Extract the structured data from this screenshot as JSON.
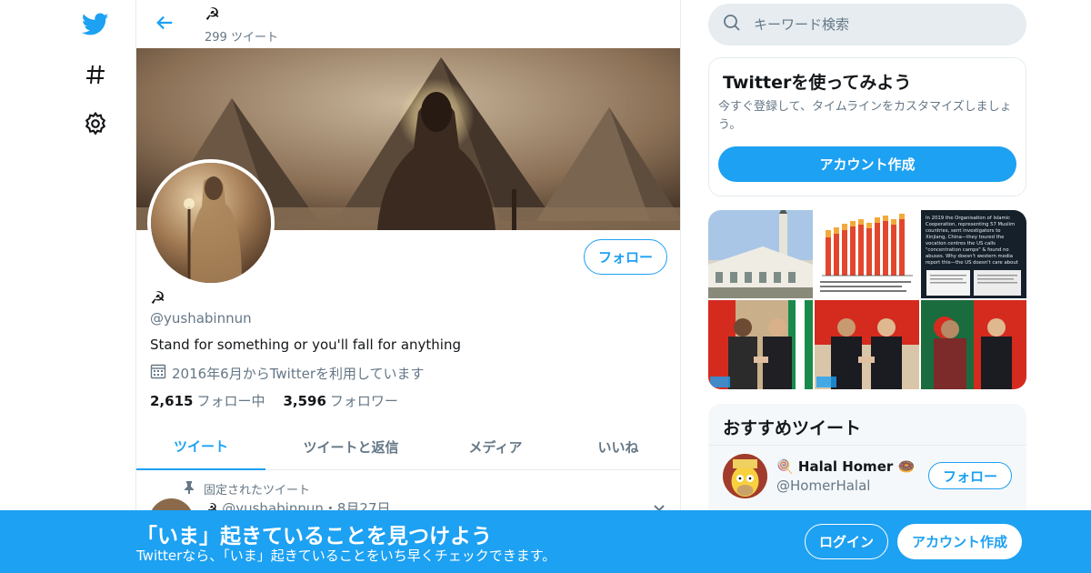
{
  "nav": {
    "icons": [
      "twitter-logo-icon",
      "hashtag-icon",
      "gear-icon"
    ]
  },
  "profile": {
    "display_name": "☭",
    "tweet_count": "299 ツイート",
    "handle": "@yushabinnun",
    "bio": "Stand for something or you'll fall for anything",
    "joined": "2016年6月からTwitterを利用しています",
    "following_count": "2,615",
    "following_label": "フォロー中",
    "followers_count": "3,596",
    "followers_label": "フォロワー",
    "follow_button": "フォロー"
  },
  "tabs": [
    {
      "label": "ツイート",
      "active": true
    },
    {
      "label": "ツイートと返信",
      "active": false
    },
    {
      "label": "メディア",
      "active": false
    },
    {
      "label": "いいね",
      "active": false
    }
  ],
  "pinned": {
    "label": "固定されたツイート",
    "author_name": "☭",
    "author_handle": "@yushabinnun",
    "date": "・8月27日"
  },
  "search": {
    "placeholder": "キーワード検索"
  },
  "signup_card": {
    "title": "Twitterを使ってみよう",
    "subtitle": "今すぐ登録して、タイムラインをカスタマイズしましょう。",
    "button": "アカウント作成"
  },
  "media_tiles": [
    {
      "kind": "mosque-photo"
    },
    {
      "kind": "bar-chart-screenshot"
    },
    {
      "kind": "text-screenshot",
      "text": "In 2019 the Organisation of Islamic Cooperation, representing 57 Muslim countries, sent investigators to Xinjiang, China—they toured the vocation centres the US calls \"concentration camps\" & found no abuses. Why doesn't western media report this—the US doesn't care about Muslims."
    },
    {
      "kind": "handshake-photo"
    },
    {
      "kind": "handshake-photo"
    },
    {
      "kind": "handshake-photo"
    }
  ],
  "recommended": {
    "title": "おすすめツイート",
    "name": "🍭 Halal Homer 🍩",
    "handle": "@HomerHalal",
    "follow_button": "フォロー"
  },
  "bottom_bar": {
    "title": "「いま」起きていることを見つけよう",
    "subtitle": "Twitterなら、「いま」起きていることをいち早くチェックできます。",
    "login": "ログイン",
    "signup": "アカウント作成"
  },
  "colors": {
    "accent": "#1da1f2",
    "text_primary": "#14171a",
    "text_secondary": "#657786",
    "border": "#e6ecf0"
  }
}
